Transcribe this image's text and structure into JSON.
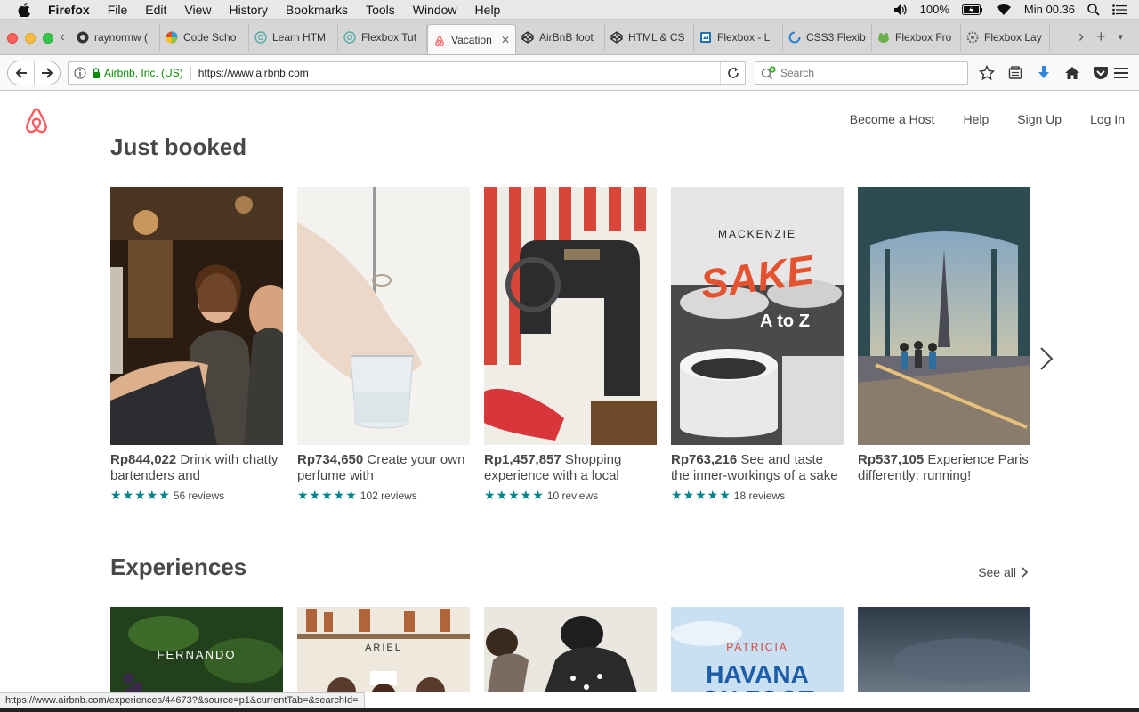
{
  "menubar": {
    "app": "Firefox",
    "items": [
      "File",
      "Edit",
      "View",
      "History",
      "Bookmarks",
      "Tools",
      "Window",
      "Help"
    ],
    "battery": "100%",
    "clock": "Min 00.36"
  },
  "tabs": [
    {
      "label": "raynormw (",
      "icon": "github-icon"
    },
    {
      "label": "Code Scho",
      "icon": "codeschool-icon"
    },
    {
      "label": "Learn HTM",
      "icon": "globe-icon"
    },
    {
      "label": "Flexbox Tut",
      "icon": "globe-icon"
    },
    {
      "label": "Vacation",
      "icon": "airbnb-icon",
      "active": true
    },
    {
      "label": "AirBnB foot",
      "icon": "codepen-icon"
    },
    {
      "label": "HTML & CS",
      "icon": "codepen-icon"
    },
    {
      "label": "Flexbox - L",
      "icon": "flexbox-icon"
    },
    {
      "label": "CSS3 Flexib",
      "icon": "loading-icon"
    },
    {
      "label": "Flexbox Fro",
      "icon": "frog-icon"
    },
    {
      "label": "Flexbox Lay",
      "icon": "gear-icon"
    }
  ],
  "urlbar": {
    "org": "Airbnb, Inc. (US)",
    "url": "https://www.airbnb.com",
    "search_placeholder": "Search"
  },
  "site": {
    "nav": [
      "Become a Host",
      "Help",
      "Sign Up",
      "Log In"
    ],
    "accent": "#ff5a5f",
    "star_color": "#008489"
  },
  "just_booked": {
    "title": "Just booked",
    "cards": [
      {
        "price": "Rp844,022",
        "text": "Drink with chatty bartenders and",
        "stars": "★★★★★",
        "reviews": "56 reviews"
      },
      {
        "price": "Rp734,650",
        "text": "Create your own perfume with",
        "stars": "★★★★★",
        "reviews": "102 reviews"
      },
      {
        "price": "Rp1,457,857",
        "text": "Shopping experience with a local",
        "stars": "★★★★★",
        "reviews": "10 reviews"
      },
      {
        "price": "Rp763,216",
        "text": "See and taste the inner-workings of a sake",
        "stars": "★★★★★",
        "reviews": "18 reviews",
        "img_title": "MACKENZIE",
        "img_big": "SAKE",
        "img_sub": "A to Z"
      },
      {
        "price": "Rp537,105",
        "text": "Experience Paris differently: running!",
        "stars": "",
        "reviews": ""
      }
    ]
  },
  "experiences": {
    "title": "Experiences",
    "see_all": "See all",
    "cards": [
      {
        "img_title": "FERNANDO"
      },
      {
        "img_title": "ARIEL"
      },
      {
        "img_title": ""
      },
      {
        "img_title": "PATRICIA",
        "img_big": "HAVANA ON FOOT"
      },
      {
        "img_title": ""
      }
    ]
  },
  "statusbar": {
    "url": "https://www.airbnb.com/experiences/44673?&source=p1&currentTab=&searchId="
  }
}
